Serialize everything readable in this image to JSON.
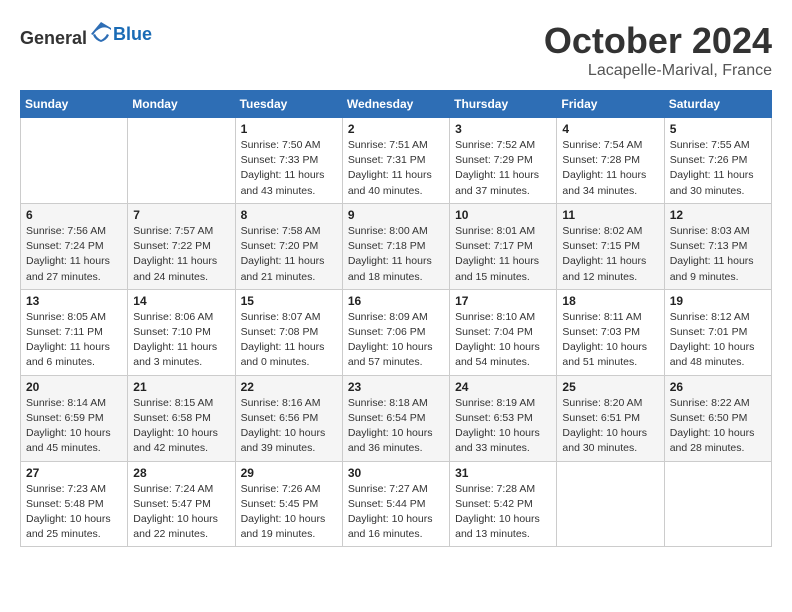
{
  "header": {
    "logo_general": "General",
    "logo_blue": "Blue",
    "month": "October 2024",
    "location": "Lacapelle-Marival, France"
  },
  "weekdays": [
    "Sunday",
    "Monday",
    "Tuesday",
    "Wednesday",
    "Thursday",
    "Friday",
    "Saturday"
  ],
  "weeks": [
    [
      {
        "day": "",
        "sunrise": "",
        "sunset": "",
        "daylight": ""
      },
      {
        "day": "",
        "sunrise": "",
        "sunset": "",
        "daylight": ""
      },
      {
        "day": "1",
        "sunrise": "Sunrise: 7:50 AM",
        "sunset": "Sunset: 7:33 PM",
        "daylight": "Daylight: 11 hours and 43 minutes."
      },
      {
        "day": "2",
        "sunrise": "Sunrise: 7:51 AM",
        "sunset": "Sunset: 7:31 PM",
        "daylight": "Daylight: 11 hours and 40 minutes."
      },
      {
        "day": "3",
        "sunrise": "Sunrise: 7:52 AM",
        "sunset": "Sunset: 7:29 PM",
        "daylight": "Daylight: 11 hours and 37 minutes."
      },
      {
        "day": "4",
        "sunrise": "Sunrise: 7:54 AM",
        "sunset": "Sunset: 7:28 PM",
        "daylight": "Daylight: 11 hours and 34 minutes."
      },
      {
        "day": "5",
        "sunrise": "Sunrise: 7:55 AM",
        "sunset": "Sunset: 7:26 PM",
        "daylight": "Daylight: 11 hours and 30 minutes."
      }
    ],
    [
      {
        "day": "6",
        "sunrise": "Sunrise: 7:56 AM",
        "sunset": "Sunset: 7:24 PM",
        "daylight": "Daylight: 11 hours and 27 minutes."
      },
      {
        "day": "7",
        "sunrise": "Sunrise: 7:57 AM",
        "sunset": "Sunset: 7:22 PM",
        "daylight": "Daylight: 11 hours and 24 minutes."
      },
      {
        "day": "8",
        "sunrise": "Sunrise: 7:58 AM",
        "sunset": "Sunset: 7:20 PM",
        "daylight": "Daylight: 11 hours and 21 minutes."
      },
      {
        "day": "9",
        "sunrise": "Sunrise: 8:00 AM",
        "sunset": "Sunset: 7:18 PM",
        "daylight": "Daylight: 11 hours and 18 minutes."
      },
      {
        "day": "10",
        "sunrise": "Sunrise: 8:01 AM",
        "sunset": "Sunset: 7:17 PM",
        "daylight": "Daylight: 11 hours and 15 minutes."
      },
      {
        "day": "11",
        "sunrise": "Sunrise: 8:02 AM",
        "sunset": "Sunset: 7:15 PM",
        "daylight": "Daylight: 11 hours and 12 minutes."
      },
      {
        "day": "12",
        "sunrise": "Sunrise: 8:03 AM",
        "sunset": "Sunset: 7:13 PM",
        "daylight": "Daylight: 11 hours and 9 minutes."
      }
    ],
    [
      {
        "day": "13",
        "sunrise": "Sunrise: 8:05 AM",
        "sunset": "Sunset: 7:11 PM",
        "daylight": "Daylight: 11 hours and 6 minutes."
      },
      {
        "day": "14",
        "sunrise": "Sunrise: 8:06 AM",
        "sunset": "Sunset: 7:10 PM",
        "daylight": "Daylight: 11 hours and 3 minutes."
      },
      {
        "day": "15",
        "sunrise": "Sunrise: 8:07 AM",
        "sunset": "Sunset: 7:08 PM",
        "daylight": "Daylight: 11 hours and 0 minutes."
      },
      {
        "day": "16",
        "sunrise": "Sunrise: 8:09 AM",
        "sunset": "Sunset: 7:06 PM",
        "daylight": "Daylight: 10 hours and 57 minutes."
      },
      {
        "day": "17",
        "sunrise": "Sunrise: 8:10 AM",
        "sunset": "Sunset: 7:04 PM",
        "daylight": "Daylight: 10 hours and 54 minutes."
      },
      {
        "day": "18",
        "sunrise": "Sunrise: 8:11 AM",
        "sunset": "Sunset: 7:03 PM",
        "daylight": "Daylight: 10 hours and 51 minutes."
      },
      {
        "day": "19",
        "sunrise": "Sunrise: 8:12 AM",
        "sunset": "Sunset: 7:01 PM",
        "daylight": "Daylight: 10 hours and 48 minutes."
      }
    ],
    [
      {
        "day": "20",
        "sunrise": "Sunrise: 8:14 AM",
        "sunset": "Sunset: 6:59 PM",
        "daylight": "Daylight: 10 hours and 45 minutes."
      },
      {
        "day": "21",
        "sunrise": "Sunrise: 8:15 AM",
        "sunset": "Sunset: 6:58 PM",
        "daylight": "Daylight: 10 hours and 42 minutes."
      },
      {
        "day": "22",
        "sunrise": "Sunrise: 8:16 AM",
        "sunset": "Sunset: 6:56 PM",
        "daylight": "Daylight: 10 hours and 39 minutes."
      },
      {
        "day": "23",
        "sunrise": "Sunrise: 8:18 AM",
        "sunset": "Sunset: 6:54 PM",
        "daylight": "Daylight: 10 hours and 36 minutes."
      },
      {
        "day": "24",
        "sunrise": "Sunrise: 8:19 AM",
        "sunset": "Sunset: 6:53 PM",
        "daylight": "Daylight: 10 hours and 33 minutes."
      },
      {
        "day": "25",
        "sunrise": "Sunrise: 8:20 AM",
        "sunset": "Sunset: 6:51 PM",
        "daylight": "Daylight: 10 hours and 30 minutes."
      },
      {
        "day": "26",
        "sunrise": "Sunrise: 8:22 AM",
        "sunset": "Sunset: 6:50 PM",
        "daylight": "Daylight: 10 hours and 28 minutes."
      }
    ],
    [
      {
        "day": "27",
        "sunrise": "Sunrise: 7:23 AM",
        "sunset": "Sunset: 5:48 PM",
        "daylight": "Daylight: 10 hours and 25 minutes."
      },
      {
        "day": "28",
        "sunrise": "Sunrise: 7:24 AM",
        "sunset": "Sunset: 5:47 PM",
        "daylight": "Daylight: 10 hours and 22 minutes."
      },
      {
        "day": "29",
        "sunrise": "Sunrise: 7:26 AM",
        "sunset": "Sunset: 5:45 PM",
        "daylight": "Daylight: 10 hours and 19 minutes."
      },
      {
        "day": "30",
        "sunrise": "Sunrise: 7:27 AM",
        "sunset": "Sunset: 5:44 PM",
        "daylight": "Daylight: 10 hours and 16 minutes."
      },
      {
        "day": "31",
        "sunrise": "Sunrise: 7:28 AM",
        "sunset": "Sunset: 5:42 PM",
        "daylight": "Daylight: 10 hours and 13 minutes."
      },
      {
        "day": "",
        "sunrise": "",
        "sunset": "",
        "daylight": ""
      },
      {
        "day": "",
        "sunrise": "",
        "sunset": "",
        "daylight": ""
      }
    ]
  ]
}
